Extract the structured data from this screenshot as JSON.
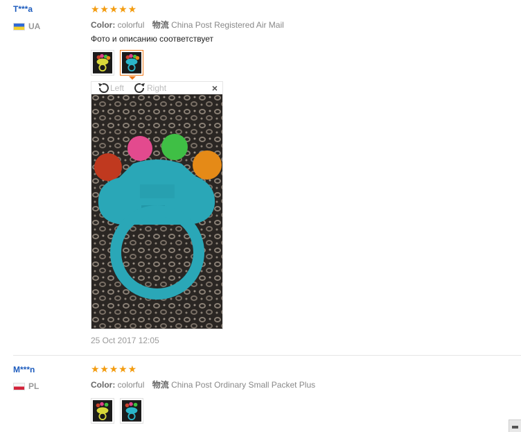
{
  "reviews": [
    {
      "user": "T***a",
      "country": "UA",
      "rating_stars": 5,
      "color_label": "Color:",
      "color_value": "colorful",
      "logistics_label": "物流",
      "logistics_value": "China Post Registered Air Mail",
      "text": "Фото и описанию соответствует",
      "viewer": {
        "rotate_left": "Left",
        "rotate_right": "Right",
        "close": "×"
      },
      "date": "25 Oct 2017 12:05"
    },
    {
      "user": "M***n",
      "country": "PL",
      "rating_stars": 5,
      "color_label": "Color:",
      "color_value": "colorful",
      "logistics_label": "物流",
      "logistics_value": "China Post Ordinary Small Packet Plus"
    }
  ],
  "colors": {
    "link": "#1c5bbd",
    "star": "#f39c10",
    "active_thumb": "#f07818"
  },
  "icons": [
    "rotate-left-icon",
    "rotate-right-icon",
    "close-icon",
    "star-icon",
    "flag-ua-icon",
    "flag-pl-icon"
  ]
}
